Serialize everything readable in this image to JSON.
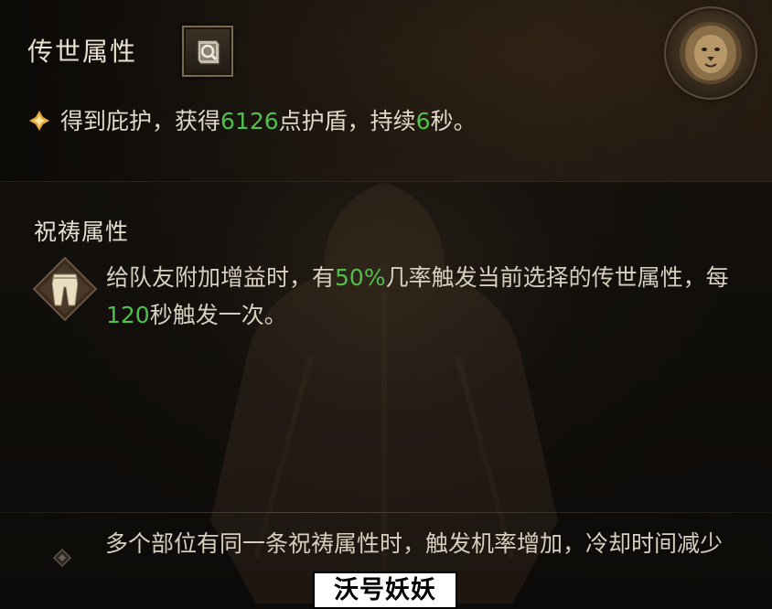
{
  "header": {
    "title": "传世属性",
    "effect": {
      "text1": "得到庇护，获得",
      "shield_value": "6126",
      "text2": "点护盾，持续",
      "duration_value": "6",
      "text3": "秒。"
    }
  },
  "blessing": {
    "title": "祝祷属性",
    "icon": "pants-icon",
    "desc": {
      "text1": "给队友附加增益时，有",
      "chance_value": "50%",
      "text2": "几率触发当前选择的传世属性，每",
      "cooldown_value": "120",
      "text3": "秒触发一次。"
    }
  },
  "tip": {
    "text": "多个部位有同一条祝祷属性时，触发机率增加，冷却时间减少"
  },
  "watermark": {
    "text": "沃号妖妖"
  },
  "colors": {
    "highlight_green": "#4fc04a",
    "text_main": "#e0d8c8",
    "gold_accent": "#e6a93a"
  }
}
